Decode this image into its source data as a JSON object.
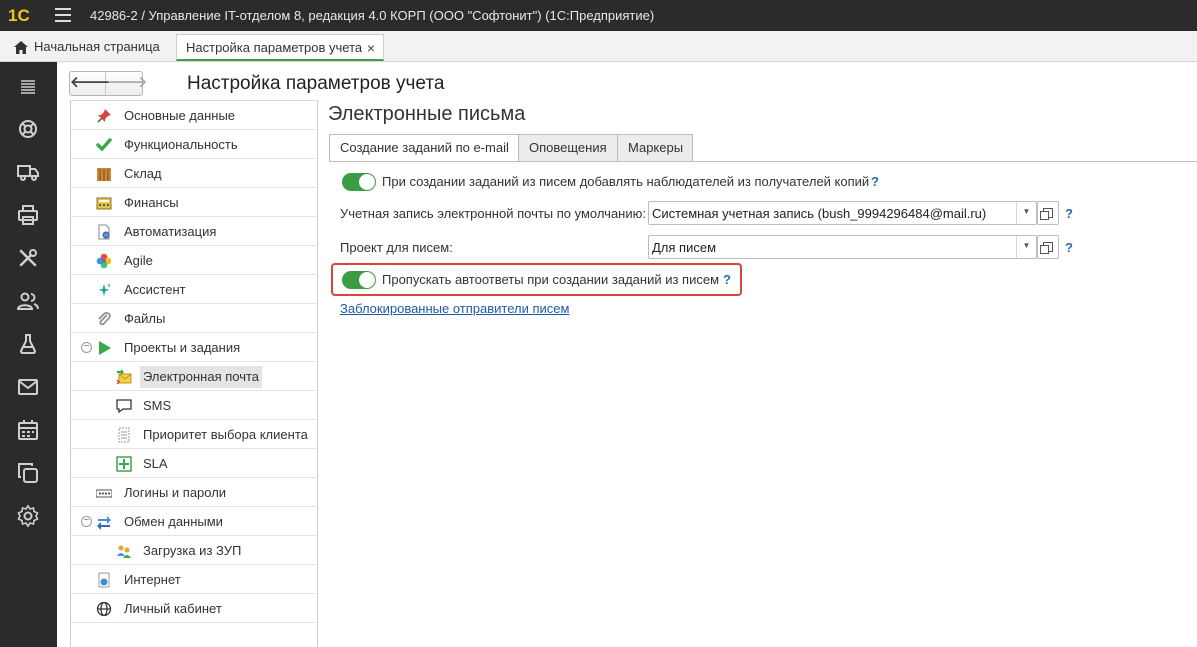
{
  "window": {
    "logo_text": "1С",
    "title": "42986-2 / Управление IT-отделом 8, редакция 4.0 КОРП (ООО \"Софтонит\")  (1С:Предприятие)"
  },
  "top_tabs": {
    "home_label": "Начальная страница",
    "active_label": "Настройка параметров учета",
    "close_glyph": "×"
  },
  "sidebar_icons": [
    "list-icon",
    "lifebuoy-icon",
    "truck-icon",
    "printer-icon",
    "tools-icon",
    "users-icon",
    "flask-icon",
    "mail-icon",
    "calendar-icon",
    "copy-icon",
    "gear-icon"
  ],
  "header": {
    "back_glyph": "🡐",
    "forward_glyph": "🡒",
    "page_title": "Настройка параметров учета"
  },
  "nav": {
    "items": [
      {
        "label": "Основные данные",
        "icon": "pin-icon"
      },
      {
        "label": "Функциональность",
        "icon": "check-icon"
      },
      {
        "label": "Склад",
        "icon": "warehouse-icon"
      },
      {
        "label": "Финансы",
        "icon": "calculator-icon"
      },
      {
        "label": "Автоматизация",
        "icon": "document-gear-icon"
      },
      {
        "label": "Agile",
        "icon": "flower-icon"
      },
      {
        "label": "Ассистент",
        "icon": "sparkle-icon"
      },
      {
        "label": "Файлы",
        "icon": "paperclip-icon"
      },
      {
        "label": "Проекты и задания",
        "icon": "play-icon"
      },
      {
        "label": "Электронная почта",
        "icon": "mail-exchange-icon"
      },
      {
        "label": "SMS",
        "icon": "speech-bubble-icon"
      },
      {
        "label": "Приоритет выбора клиента",
        "icon": "list-doc-icon"
      },
      {
        "label": "SLA",
        "icon": "sla-grid-icon"
      },
      {
        "label": "Логины и пароли",
        "icon": "password-icon"
      },
      {
        "label": "Обмен данными",
        "icon": "exchange-icon"
      },
      {
        "label": "Загрузка из ЗУП",
        "icon": "users-import-icon"
      },
      {
        "label": "Интернет",
        "icon": "internet-icon"
      },
      {
        "label": "Личный кабинет",
        "icon": "globe-icon"
      }
    ],
    "collapse_glyph": "−"
  },
  "main": {
    "section_title": "Электронные письма",
    "tabs": [
      {
        "label": "Создание заданий по e-mail"
      },
      {
        "label": "Оповещения"
      },
      {
        "label": "Маркеры"
      }
    ],
    "add_watchers_label": "При создании заданий из писем добавлять наблюдателей из получателей копий",
    "add_watchers_on": true,
    "default_account_label": "Учетная запись электронной почты по умолчанию:",
    "default_account_value": "Системная учетная запись (bush_9994296484@mail.ru)",
    "project_label": "Проект для писем:",
    "project_value": "Для писем",
    "skip_autoreplies_label": "Пропускать автоответы при создании заданий из писем",
    "skip_autoreplies_on": true,
    "blocked_senders_link": "Заблокированные отправители писем",
    "help_glyph": "?",
    "dropdown_glyph": "▼"
  },
  "colors": {
    "title_bar": "#2b2b2b",
    "toggle_on": "#3a9c43",
    "highlight_border": "#d9453b",
    "link": "#1f5aa6"
  }
}
